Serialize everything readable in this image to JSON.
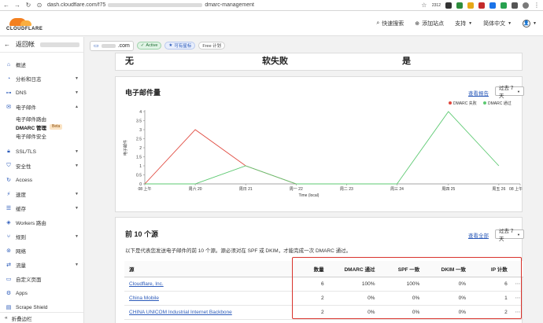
{
  "browser": {
    "url_prefix": "dash.cloudflare.com/f75",
    "url_suffix": "dmarc-management",
    "ext_text": "2312"
  },
  "header": {
    "logo_text": "CLOUDFLARE",
    "search": "快速搜索",
    "add_site": "添加站点",
    "support": "支持",
    "language": "简体中文"
  },
  "sidebar": {
    "back_label": "返回帐",
    "items": [
      {
        "label": "概述",
        "icon": "home-icon",
        "chev": false
      },
      {
        "label": "分析和日志",
        "icon": "chart-icon",
        "chev": true
      },
      {
        "label": "DNS",
        "icon": "dns-icon",
        "chev": true
      },
      {
        "label": "电子邮件",
        "icon": "mail-icon",
        "chev": true
      }
    ],
    "email_sub": [
      {
        "label": "电子邮件路由"
      },
      {
        "label": "DMARC 管理",
        "badge": "Beta"
      },
      {
        "label": "电子邮件安全"
      }
    ],
    "items2": [
      {
        "label": "SSL/TLS",
        "icon": "lock-icon",
        "chev": true
      },
      {
        "label": "安全性",
        "icon": "shield-icon",
        "chev": true
      },
      {
        "label": "Access",
        "icon": "access-icon",
        "chev": false
      },
      {
        "label": "速度",
        "icon": "speed-icon",
        "chev": true
      },
      {
        "label": "缓存",
        "icon": "cache-icon",
        "chev": true
      },
      {
        "label": "Workers 路由",
        "icon": "workers-icon",
        "chev": false
      },
      {
        "label": "规则",
        "icon": "rules-icon",
        "chev": true
      },
      {
        "label": "网络",
        "icon": "network-icon",
        "chev": false
      },
      {
        "label": "流量",
        "icon": "traffic-icon",
        "chev": true
      },
      {
        "label": "自定义页面",
        "icon": "page-icon",
        "chev": false
      },
      {
        "label": "Apps",
        "icon": "apps-icon",
        "chev": false
      },
      {
        "label": "Scrape Shield",
        "icon": "scrape-icon",
        "chev": false
      }
    ],
    "collapse_label": "折叠边栏"
  },
  "zone": {
    "domain_suffix": ".com",
    "active": "Active",
    "star": "可有星标",
    "plan": "Free 计划"
  },
  "summary": {
    "values": [
      "无",
      "软失败",
      "是"
    ]
  },
  "volume": {
    "title": "电子邮件量",
    "view_report": "查看报告",
    "range": "过去 7 天",
    "legend": [
      {
        "name": "DMARC 失败",
        "color": "#e0483e"
      },
      {
        "name": "DMARC 通过",
        "color": "#5cc971"
      }
    ]
  },
  "chart_data": {
    "type": "line",
    "ylabel": "电子邮件",
    "xlabel": "Time (local)",
    "ylim": [
      0,
      4
    ],
    "y_ticks": [
      "0",
      "0.5",
      "1",
      "1.5",
      "2",
      "2.5",
      "3",
      "3.5",
      "4"
    ],
    "categories": [
      "08 上午",
      "周六 20",
      "周日 21",
      "周一 22",
      "周二 23",
      "周三 24",
      "周四 25",
      "周五 26",
      "08 上午"
    ],
    "series": [
      {
        "name": "DMARC 失败",
        "color": "#e0483e",
        "values": [
          0,
          3,
          1,
          0,
          0,
          0,
          null,
          null,
          null
        ]
      },
      {
        "name": "DMARC 通过",
        "color": "#5cc971",
        "values": [
          0,
          0,
          1,
          0,
          0,
          0,
          4,
          1,
          null
        ]
      }
    ],
    "x_positions": [
      0,
      1.04,
      2.08,
      3.12,
      4.16,
      5.2,
      6.26,
      7.3,
      7.74
    ],
    "legend_position": "top-right",
    "grid": false
  },
  "sources": {
    "title": "前 10 个源",
    "view_all": "查看全部",
    "range": "过去 7 天",
    "description": "以下是代表您发送电子邮件的前 10 个源。源必须对在 SPF 或 DKIM，才能完成一次 DMARC 通过。",
    "columns": [
      "源",
      "数量",
      "DMARC 通过",
      "SPF 一致",
      "DKIM 一致",
      "IP 计数"
    ],
    "rows": [
      {
        "source": "Cloudflare, Inc.",
        "count": "6",
        "dmarc": "100%",
        "spf": "100%",
        "dkim": "0%",
        "ip": "6"
      },
      {
        "source": "China Mobile",
        "count": "2",
        "dmarc": "0%",
        "spf": "0%",
        "dkim": "0%",
        "ip": "1"
      },
      {
        "source": "CHINA UNICOM Industrial Internet Backbone",
        "count": "2",
        "dmarc": "0%",
        "spf": "0%",
        "dkim": "0%",
        "ip": "2"
      }
    ]
  }
}
